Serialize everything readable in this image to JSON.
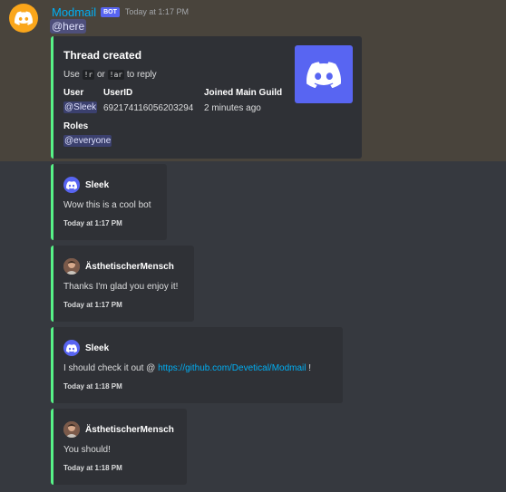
{
  "message": {
    "username": "Modmail",
    "bot_tag": "BOT",
    "timestamp": "Today at 1:17 PM",
    "mention": "@here"
  },
  "embed": {
    "title": "Thread created",
    "desc_prefix": "Use ",
    "cmd1": "!r",
    "desc_or": " or ",
    "cmd2": "!ar",
    "desc_suffix": " to reply",
    "fields": {
      "user_name": "User",
      "user_value": "@Sleek",
      "userid_name": "UserID",
      "userid_value": "692174116056203294",
      "joined_name": "Joined Main Guild",
      "joined_value": "2 minutes ago",
      "roles_name": "Roles",
      "roles_value": "@everyone"
    },
    "thumbnail_icon": "discord-logo-icon"
  },
  "messages": [
    {
      "author": "Sleek",
      "avatar": "discord-logo-icon",
      "text": "Wow this is a cool bot",
      "footer": "Today at 1:17 PM"
    },
    {
      "author": "ÄsthetischerMensch",
      "avatar": "person-avatar-icon",
      "text": "Thanks I'm glad you enjoy it!",
      "footer": "Today at 1:17 PM"
    },
    {
      "author": "Sleek",
      "avatar": "discord-logo-icon",
      "text_prefix": "I should check it out @ ",
      "link": "https://github.com/Devetical/Modmail",
      "text_suffix": " !",
      "footer": "Today at 1:18 PM"
    },
    {
      "author": "ÄsthetischerMensch",
      "avatar": "person-avatar-icon",
      "text": "You should!",
      "footer": "Today at 1:18 PM"
    }
  ],
  "colors": {
    "background": "#36393f",
    "highlight": "#49443c",
    "embed_bg": "#2f3136",
    "embed_border": "#57f287",
    "blurple": "#5865f2",
    "link": "#00aff4",
    "avatar_bg": "#faa61a"
  }
}
